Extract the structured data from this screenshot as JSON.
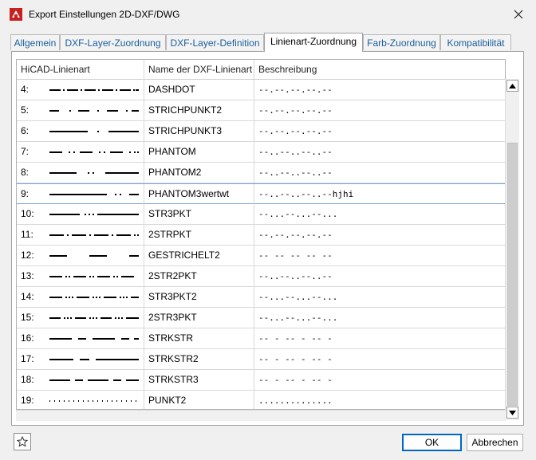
{
  "window": {
    "title": "Export Einstellungen 2D-DXF/DWG",
    "brand_color": "#c8201f"
  },
  "tabs": [
    {
      "label": "Allgemein"
    },
    {
      "label": "DXF-Layer-Zuordnung"
    },
    {
      "label": "DXF-Layer-Definition"
    },
    {
      "label": "Linienart-Zuordnung",
      "active": true
    },
    {
      "label": "Farb-Zuordnung"
    },
    {
      "label": "Kompatibilität"
    }
  ],
  "table": {
    "columns": [
      "HiCAD-Linienart",
      "Name der DXF-Linienart",
      "Beschreibung"
    ],
    "selected_row": 5,
    "rows": [
      {
        "num": "4:",
        "pattern": "dashdot",
        "name": "DASHDOT",
        "desc": "--.--.--.--.--"
      },
      {
        "num": "5:",
        "pattern": "strichp2",
        "name": "STRICHPUNKT2",
        "desc": "--.--.--.--.--"
      },
      {
        "num": "6:",
        "pattern": "strichp3",
        "name": "STRICHPUNKT3",
        "desc": "--.--.--.--.--"
      },
      {
        "num": "7:",
        "pattern": "phantom",
        "name": "PHANTOM",
        "desc": "--..--..--..--"
      },
      {
        "num": "8:",
        "pattern": "phantom2",
        "name": "PHANTOM2",
        "desc": "--..--..--..--"
      },
      {
        "num": "9:",
        "pattern": "phantom3",
        "name": "PHANTOM3wertwt",
        "desc": "--..--..--..--hjhi"
      },
      {
        "num": "10:",
        "pattern": "str3pkt",
        "name": "STR3PKT",
        "desc": "--...--...--..."
      },
      {
        "num": "11:",
        "pattern": "2strpkt",
        "name": "2STRPKT",
        "desc": "--.--.--.--.--"
      },
      {
        "num": "12:",
        "pattern": "gestr2",
        "name": "GESTRICHELT2",
        "desc": "-- -- -- -- --"
      },
      {
        "num": "13:",
        "pattern": "2str2pkt",
        "name": "2STR2PKT",
        "desc": "--..--..--..--"
      },
      {
        "num": "14:",
        "pattern": "str3pkt2",
        "name": "STR3PKT2",
        "desc": "--...--...--..."
      },
      {
        "num": "15:",
        "pattern": "2str3pkt",
        "name": "2STR3PKT",
        "desc": "--...--...--..."
      },
      {
        "num": "16:",
        "pattern": "strkstr",
        "name": "STRKSTR",
        "desc": "-- - -- - -- -"
      },
      {
        "num": "17:",
        "pattern": "strkstr2",
        "name": "STRKSTR2",
        "desc": "-- - -- - -- -"
      },
      {
        "num": "18:",
        "pattern": "strkstr3",
        "name": "STRKSTR3",
        "desc": "-- - -- - -- -"
      },
      {
        "num": "19:",
        "pattern": "punkt2",
        "name": "PUNKT2",
        "desc": ".............."
      }
    ]
  },
  "buttons": {
    "ok": "OK",
    "cancel": "Abbrechen"
  },
  "icons": {
    "app": "hicad-logo-icon",
    "close": "close-icon",
    "favorite": "star-icon",
    "scroll_up": "arrow-up-icon",
    "scroll_down": "arrow-down-icon"
  }
}
